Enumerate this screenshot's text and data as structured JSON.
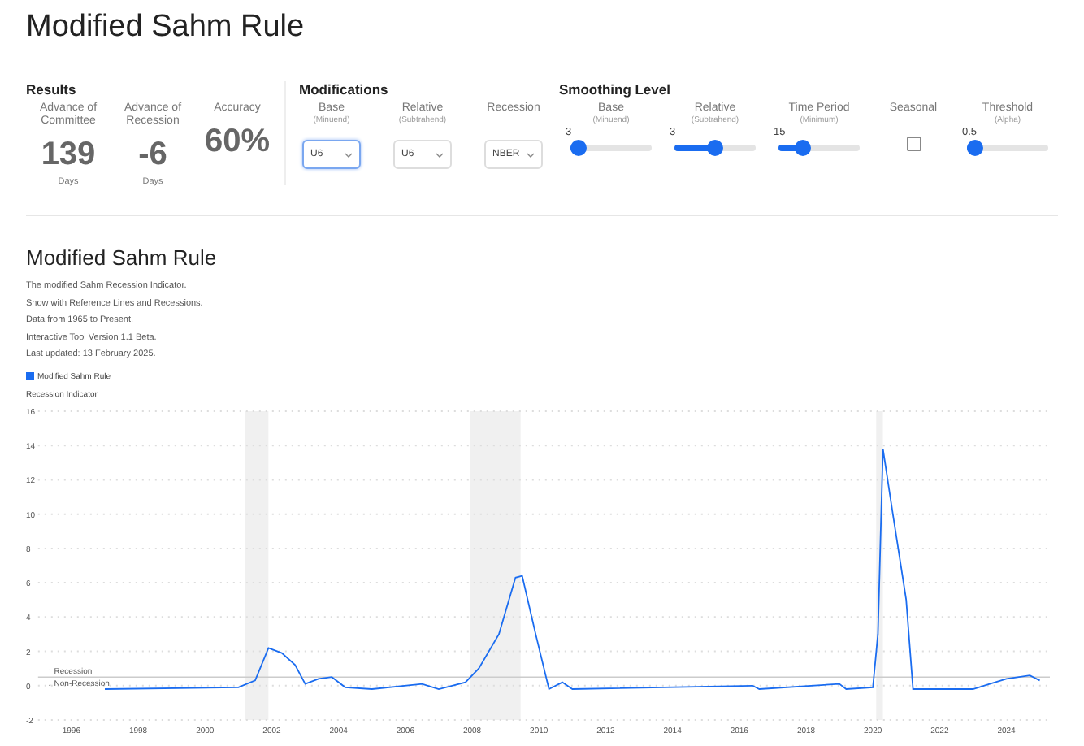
{
  "title": "Modified Sahm Rule",
  "results": {
    "heading": "Results",
    "metrics": [
      {
        "label": "Advance of Committee",
        "value": "139",
        "unit": "Days"
      },
      {
        "label": "Advance of Recession",
        "value": "-6",
        "unit": "Days"
      },
      {
        "label": "Accuracy",
        "value": "60%"
      }
    ]
  },
  "modifications": {
    "heading": "Modifications",
    "selects": [
      {
        "label": "Base",
        "sublabel": "(Minuend)",
        "value": "U6",
        "focused": true
      },
      {
        "label": "Relative",
        "sublabel": "(Subtrahend)",
        "value": "U6",
        "focused": false
      },
      {
        "label": "Recession",
        "value": "NBER",
        "focused": false
      }
    ]
  },
  "smoothing": {
    "heading": "Smoothing Level",
    "controls": [
      {
        "kind": "slider",
        "label": "Base",
        "sublabel": "(Minuend)",
        "reading": "3",
        "level": 0.1
      },
      {
        "kind": "slider",
        "label": "Relative",
        "sublabel": "(Subtrahend)",
        "reading": "3",
        "level": 0.5
      },
      {
        "kind": "slider",
        "label": "Time Period",
        "sublabel": "(Minimum)",
        "reading": "15",
        "level": 0.3
      },
      {
        "kind": "checkbox",
        "label": "Seasonal",
        "checked": false
      },
      {
        "kind": "slider",
        "label": "Threshold",
        "sublabel": "(Alpha)",
        "reading": "0.5",
        "level": 0.1
      }
    ]
  },
  "chart_section": {
    "title": "Modified Sahm Rule",
    "description": [
      "The modified Sahm Recession Indicator.",
      "Show with Reference Lines and Recessions.",
      "Data from 1965 to Present.",
      "Interactive Tool Version 1.1 Beta.",
      "Last updated: 13 February 2025."
    ],
    "chart_data": {
      "type": "line",
      "ylabel": "Recession Indicator",
      "xlim": [
        1995,
        2025.3
      ],
      "ylim": [
        -2,
        16
      ],
      "grid": true,
      "xticks": [
        1996,
        1998,
        2000,
        2002,
        2004,
        2006,
        2008,
        2010,
        2012,
        2014,
        2016,
        2018,
        2020,
        2022,
        2024
      ],
      "yticks": [
        -2,
        0,
        2,
        4,
        6,
        8,
        10,
        12,
        14,
        16
      ],
      "x": [
        1997,
        2001,
        2001.5,
        2001.9,
        2002.3,
        2002.7,
        2003,
        2003.4,
        2003.8,
        2004.2,
        2005,
        2006.5,
        2007,
        2007.8,
        2008.2,
        2008.8,
        2009.3,
        2009.5,
        2009.9,
        2010.3,
        2010.7,
        2011,
        2016.4,
        2016.6,
        2019,
        2019.2,
        2020,
        2020.15,
        2020.3,
        2020.6,
        2021,
        2021.2,
        2023,
        2023.5,
        2024,
        2024.7,
        2025
      ],
      "series": [
        {
          "name": "Modified Sahm Rule",
          "color": "#1a6cf0",
          "values": [
            -0.2,
            -0.1,
            0.3,
            2.2,
            1.9,
            1.2,
            0.1,
            0.4,
            0.5,
            -0.1,
            -0.2,
            0.1,
            -0.2,
            0.2,
            1.0,
            3.0,
            6.3,
            6.4,
            3.0,
            -0.2,
            0.2,
            -0.2,
            0.0,
            -0.2,
            0.1,
            -0.2,
            -0.1,
            3.0,
            13.8,
            10.0,
            5.0,
            -0.2,
            -0.2,
            0.1,
            0.4,
            0.6,
            0.3
          ]
        }
      ],
      "ref_lines": [
        {
          "axis": "y",
          "value": 0.5
        }
      ],
      "bands": [
        {
          "axis": "x",
          "from": 2001.2,
          "to": 2001.9
        },
        {
          "axis": "x",
          "from": 2007.95,
          "to": 2009.45
        },
        {
          "axis": "x",
          "from": 2020.1,
          "to": 2020.3
        }
      ],
      "annotations": [
        "↑ Recession",
        "↓ Non-Recession"
      ]
    }
  }
}
